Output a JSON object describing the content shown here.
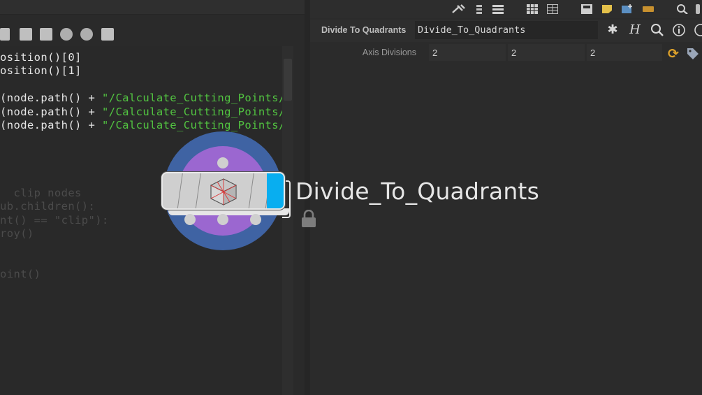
{
  "editor": {
    "lines": [
      {
        "pre": "osition()[0]",
        "str": "",
        "dim": false
      },
      {
        "pre": "osition()[1]",
        "str": "",
        "dim": false
      },
      {
        "pre": "",
        "str": "",
        "dim": false
      },
      {
        "pre": "(node.path() + ",
        "str": "\"/Calculate_Cutting_Points/X",
        "dim": false
      },
      {
        "pre": "(node.path() + ",
        "str": "\"/Calculate_Cutting_Points/Y",
        "dim": false
      },
      {
        "pre": "(node.path() + ",
        "str": "\"/Calculate_Cutting_Points/Z",
        "dim": false
      },
      {
        "pre": "",
        "str": "",
        "dim": false
      },
      {
        "pre": "",
        "str": "",
        "dim": false
      },
      {
        "pre": "",
        "str": "",
        "dim": false
      },
      {
        "pre": "",
        "str": "",
        "dim": false
      },
      {
        "pre": "  clip nodes",
        "str": "",
        "dim": true
      },
      {
        "pre": "ub.children():",
        "str": "",
        "dim": true
      },
      {
        "pre": "nt() == \"clip\"):",
        "str": "",
        "dim": true
      },
      {
        "pre": "roy()",
        "str": "",
        "dim": true
      },
      {
        "pre": "",
        "str": "",
        "dim": false
      },
      {
        "pre": "",
        "str": "",
        "dim": false
      },
      {
        "pre": "oint()",
        "str": "",
        "dim": true
      }
    ]
  },
  "node_header": {
    "type_label": "Divide To Quadrants",
    "name_value": "Divide_To_Quadrants"
  },
  "params": {
    "axis_divisions": {
      "label": "Axis Divisions",
      "values": [
        "2",
        "2",
        "2"
      ]
    }
  },
  "node": {
    "title": "Divide_To_Quadrants",
    "colors": {
      "ring": "#3f63a3",
      "ring_inner": "#9b67d0",
      "flag": "#08aef0",
      "string_literal": "#52c441",
      "refresh": "#e0a32a"
    }
  },
  "icons": {
    "toolbar": [
      "pin-icon",
      "tree-icon",
      "list-icon",
      "grid-icon",
      "table-icon",
      "save-icon",
      "note-icon",
      "image-add-icon",
      "box-icon",
      "search-icon"
    ],
    "header": [
      "gear-icon",
      "help-h-icon",
      "magnify-icon",
      "info-icon"
    ],
    "editor_toolbar": [
      "indent-icon",
      "import-icon",
      "export-icon",
      "comment-icon",
      "speech-icon",
      "edit-icon"
    ]
  }
}
